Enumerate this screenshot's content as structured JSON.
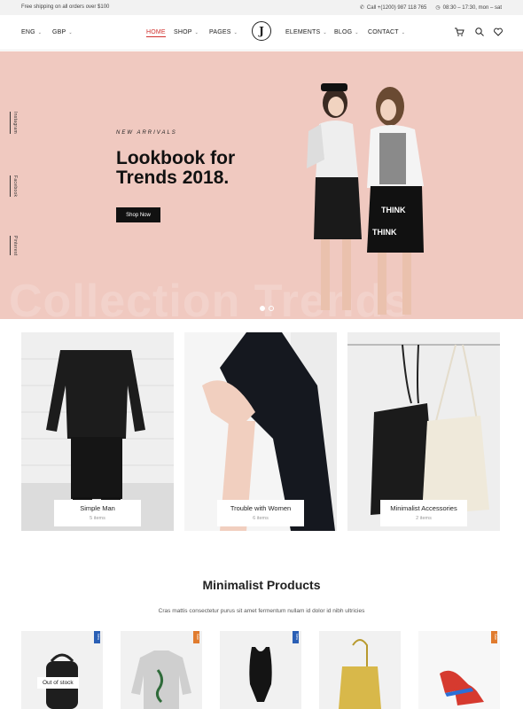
{
  "topbar": {
    "shipping": "Free shipping on all orders over $100",
    "phone": "Call +(1200) 987 118 765",
    "hours": "08:30 – 17:30, mon – sat"
  },
  "header": {
    "lang": "ENG",
    "currency": "GBP",
    "logo": "J",
    "nav": [
      "HOME",
      "SHOP",
      "PAGES",
      "ELEMENTS",
      "BLOG",
      "CONTACT"
    ]
  },
  "hero": {
    "social": [
      "Instagram",
      "Facebook",
      "Pinterest"
    ],
    "kicker": "NEW ARRIVALS",
    "title_line1": "Lookbook for",
    "title_line2": "Trends 2018.",
    "button": "Shop Now",
    "background_text": "Collection Trends",
    "colors": {
      "background": "#f0c9c0"
    }
  },
  "categories": [
    {
      "name": "Simple Man",
      "count": "5 items"
    },
    {
      "name": "Trouble with Women",
      "count": "6 items"
    },
    {
      "name": "Minimalist Accessories",
      "count": "2 items"
    }
  ],
  "products_section": {
    "title": "Minimalist Products",
    "subtitle": "Cras mattis consectetur purus sit amet fermentum nullam id dolor id nibh ultricies",
    "out_of_stock": "Out of stock",
    "tags": [
      "New",
      "Sale",
      "New",
      "Sale"
    ]
  },
  "icons": [
    "clock-icon",
    "phone-icon",
    "cart-icon",
    "search-icon",
    "heart-icon",
    "chevron-down-icon"
  ]
}
